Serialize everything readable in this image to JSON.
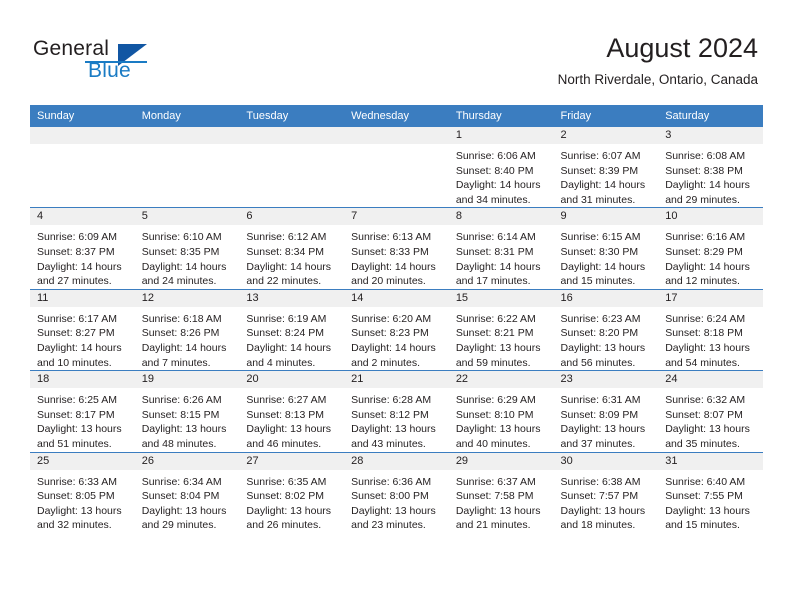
{
  "brand": {
    "name_part1": "General",
    "name_part2": "Blue",
    "triangle_color": "#1156a3",
    "blue_color": "#1a7bc4"
  },
  "header": {
    "title": "August 2024",
    "location": "North Riverdale, Ontario, Canada"
  },
  "theme": {
    "header_blue": "#3b7dc0",
    "daynum_band": "#f0f0f0",
    "text": "#231f20"
  },
  "calendar": {
    "weekday_headers": [
      "Sunday",
      "Monday",
      "Tuesday",
      "Wednesday",
      "Thursday",
      "Friday",
      "Saturday"
    ],
    "weeks": [
      [
        {
          "day": "",
          "sunrise": "",
          "sunset": "",
          "daylight": "",
          "empty": true
        },
        {
          "day": "",
          "sunrise": "",
          "sunset": "",
          "daylight": "",
          "empty": true
        },
        {
          "day": "",
          "sunrise": "",
          "sunset": "",
          "daylight": "",
          "empty": true
        },
        {
          "day": "",
          "sunrise": "",
          "sunset": "",
          "daylight": "",
          "empty": true
        },
        {
          "day": "1",
          "sunrise": "Sunrise: 6:06 AM",
          "sunset": "Sunset: 8:40 PM",
          "daylight": "Daylight: 14 hours and 34 minutes."
        },
        {
          "day": "2",
          "sunrise": "Sunrise: 6:07 AM",
          "sunset": "Sunset: 8:39 PM",
          "daylight": "Daylight: 14 hours and 31 minutes."
        },
        {
          "day": "3",
          "sunrise": "Sunrise: 6:08 AM",
          "sunset": "Sunset: 8:38 PM",
          "daylight": "Daylight: 14 hours and 29 minutes."
        }
      ],
      [
        {
          "day": "4",
          "sunrise": "Sunrise: 6:09 AM",
          "sunset": "Sunset: 8:37 PM",
          "daylight": "Daylight: 14 hours and 27 minutes."
        },
        {
          "day": "5",
          "sunrise": "Sunrise: 6:10 AM",
          "sunset": "Sunset: 8:35 PM",
          "daylight": "Daylight: 14 hours and 24 minutes."
        },
        {
          "day": "6",
          "sunrise": "Sunrise: 6:12 AM",
          "sunset": "Sunset: 8:34 PM",
          "daylight": "Daylight: 14 hours and 22 minutes."
        },
        {
          "day": "7",
          "sunrise": "Sunrise: 6:13 AM",
          "sunset": "Sunset: 8:33 PM",
          "daylight": "Daylight: 14 hours and 20 minutes."
        },
        {
          "day": "8",
          "sunrise": "Sunrise: 6:14 AM",
          "sunset": "Sunset: 8:31 PM",
          "daylight": "Daylight: 14 hours and 17 minutes."
        },
        {
          "day": "9",
          "sunrise": "Sunrise: 6:15 AM",
          "sunset": "Sunset: 8:30 PM",
          "daylight": "Daylight: 14 hours and 15 minutes."
        },
        {
          "day": "10",
          "sunrise": "Sunrise: 6:16 AM",
          "sunset": "Sunset: 8:29 PM",
          "daylight": "Daylight: 14 hours and 12 minutes."
        }
      ],
      [
        {
          "day": "11",
          "sunrise": "Sunrise: 6:17 AM",
          "sunset": "Sunset: 8:27 PM",
          "daylight": "Daylight: 14 hours and 10 minutes."
        },
        {
          "day": "12",
          "sunrise": "Sunrise: 6:18 AM",
          "sunset": "Sunset: 8:26 PM",
          "daylight": "Daylight: 14 hours and 7 minutes."
        },
        {
          "day": "13",
          "sunrise": "Sunrise: 6:19 AM",
          "sunset": "Sunset: 8:24 PM",
          "daylight": "Daylight: 14 hours and 4 minutes."
        },
        {
          "day": "14",
          "sunrise": "Sunrise: 6:20 AM",
          "sunset": "Sunset: 8:23 PM",
          "daylight": "Daylight: 14 hours and 2 minutes."
        },
        {
          "day": "15",
          "sunrise": "Sunrise: 6:22 AM",
          "sunset": "Sunset: 8:21 PM",
          "daylight": "Daylight: 13 hours and 59 minutes."
        },
        {
          "day": "16",
          "sunrise": "Sunrise: 6:23 AM",
          "sunset": "Sunset: 8:20 PM",
          "daylight": "Daylight: 13 hours and 56 minutes."
        },
        {
          "day": "17",
          "sunrise": "Sunrise: 6:24 AM",
          "sunset": "Sunset: 8:18 PM",
          "daylight": "Daylight: 13 hours and 54 minutes."
        }
      ],
      [
        {
          "day": "18",
          "sunrise": "Sunrise: 6:25 AM",
          "sunset": "Sunset: 8:17 PM",
          "daylight": "Daylight: 13 hours and 51 minutes."
        },
        {
          "day": "19",
          "sunrise": "Sunrise: 6:26 AM",
          "sunset": "Sunset: 8:15 PM",
          "daylight": "Daylight: 13 hours and 48 minutes."
        },
        {
          "day": "20",
          "sunrise": "Sunrise: 6:27 AM",
          "sunset": "Sunset: 8:13 PM",
          "daylight": "Daylight: 13 hours and 46 minutes."
        },
        {
          "day": "21",
          "sunrise": "Sunrise: 6:28 AM",
          "sunset": "Sunset: 8:12 PM",
          "daylight": "Daylight: 13 hours and 43 minutes."
        },
        {
          "day": "22",
          "sunrise": "Sunrise: 6:29 AM",
          "sunset": "Sunset: 8:10 PM",
          "daylight": "Daylight: 13 hours and 40 minutes."
        },
        {
          "day": "23",
          "sunrise": "Sunrise: 6:31 AM",
          "sunset": "Sunset: 8:09 PM",
          "daylight": "Daylight: 13 hours and 37 minutes."
        },
        {
          "day": "24",
          "sunrise": "Sunrise: 6:32 AM",
          "sunset": "Sunset: 8:07 PM",
          "daylight": "Daylight: 13 hours and 35 minutes."
        }
      ],
      [
        {
          "day": "25",
          "sunrise": "Sunrise: 6:33 AM",
          "sunset": "Sunset: 8:05 PM",
          "daylight": "Daylight: 13 hours and 32 minutes."
        },
        {
          "day": "26",
          "sunrise": "Sunrise: 6:34 AM",
          "sunset": "Sunset: 8:04 PM",
          "daylight": "Daylight: 13 hours and 29 minutes."
        },
        {
          "day": "27",
          "sunrise": "Sunrise: 6:35 AM",
          "sunset": "Sunset: 8:02 PM",
          "daylight": "Daylight: 13 hours and 26 minutes."
        },
        {
          "day": "28",
          "sunrise": "Sunrise: 6:36 AM",
          "sunset": "Sunset: 8:00 PM",
          "daylight": "Daylight: 13 hours and 23 minutes."
        },
        {
          "day": "29",
          "sunrise": "Sunrise: 6:37 AM",
          "sunset": "Sunset: 7:58 PM",
          "daylight": "Daylight: 13 hours and 21 minutes."
        },
        {
          "day": "30",
          "sunrise": "Sunrise: 6:38 AM",
          "sunset": "Sunset: 7:57 PM",
          "daylight": "Daylight: 13 hours and 18 minutes."
        },
        {
          "day": "31",
          "sunrise": "Sunrise: 6:40 AM",
          "sunset": "Sunset: 7:55 PM",
          "daylight": "Daylight: 13 hours and 15 minutes."
        }
      ]
    ]
  }
}
